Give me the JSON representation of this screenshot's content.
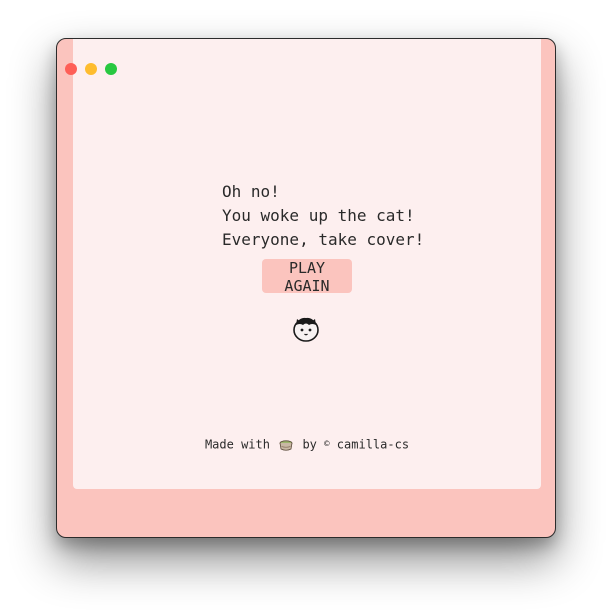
{
  "window": {
    "controls": [
      "close",
      "minimize",
      "maximize"
    ]
  },
  "game": {
    "message_lines": [
      "Oh no!",
      "You woke up the cat!",
      "Everyone, take cover!"
    ],
    "play_again_label": "PLAY AGAIN",
    "cat_icon": "cat-face-icon"
  },
  "footer": {
    "prefix": "Made with",
    "icon": "matcha-icon",
    "by": "by",
    "copyright": "©",
    "author": "camilla-cs"
  },
  "colors": {
    "frame": "#fbc4be",
    "panel": "#fdefef",
    "button": "#fbc4be",
    "text": "#2a2a2a"
  }
}
